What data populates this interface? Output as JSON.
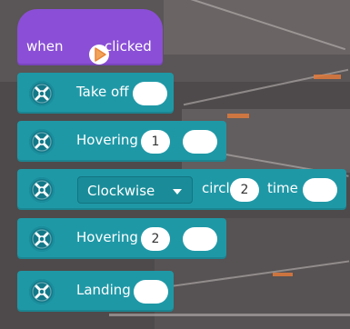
{
  "hat_block": {
    "when_label": "when",
    "clicked_label": "clicked",
    "colors": {
      "block": "#8a4fd6",
      "flag": "#f2a35a"
    }
  },
  "blocks": [
    {
      "label": "Take off",
      "icon": "drone-icon"
    },
    {
      "label": "Hovering",
      "value": "1",
      "icon": "drone-icon"
    },
    {
      "dropdown_value": "Clockwise",
      "circle_label": "circle",
      "value": "2",
      "time_label": "time",
      "icon": "drone-icon"
    },
    {
      "label": "Hovering",
      "value": "2",
      "icon": "drone-icon"
    },
    {
      "label": "Landing",
      "icon": "drone-icon"
    }
  ],
  "colors": {
    "block": "#1f98a6",
    "icon_bg": "#137888",
    "input": "#ffffff"
  }
}
